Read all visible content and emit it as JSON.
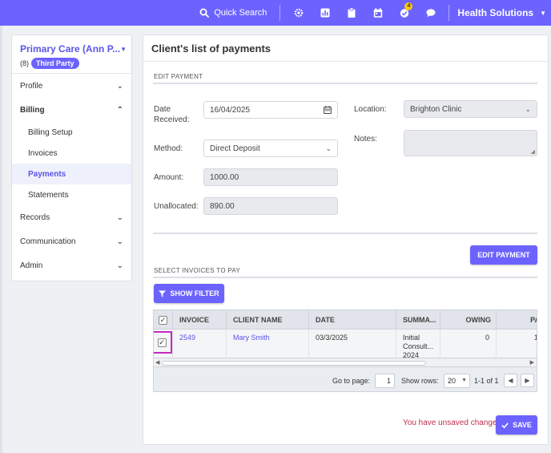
{
  "topbar": {
    "quick_search": "Quick Search",
    "org_name": "Health Solutions",
    "notifications_badge": "4",
    "accent": "#6c63ff"
  },
  "sidebar": {
    "patient_name": "Primary Care (Ann P...",
    "patient_count": "(8)",
    "patient_badge": "Third Party",
    "items": [
      {
        "label": "Profile",
        "chevron": "down"
      },
      {
        "label": "Billing",
        "chevron": "up"
      },
      {
        "label": "Records",
        "chevron": "down"
      },
      {
        "label": "Communication",
        "chevron": "down"
      },
      {
        "label": "Admin",
        "chevron": "down"
      }
    ],
    "billing_sub": [
      "Billing Setup",
      "Invoices",
      "Payments",
      "Statements"
    ],
    "active_sub": "Payments"
  },
  "main": {
    "title": "Client's list of payments",
    "edit_section": "EDIT PAYMENT",
    "form": {
      "date_label_1": "Date",
      "date_label_2": "Received:",
      "date_value": "16/04/2025",
      "method_label": "Method:",
      "method_value": "Direct Deposit",
      "amount_label": "Amount:",
      "amount_value": "1000.00",
      "unallocated_label": "Unallocated:",
      "unallocated_value": "890.00",
      "location_label": "Location:",
      "location_value": "Brighton Clinic",
      "notes_label": "Notes:",
      "notes_value": ""
    },
    "edit_button": "EDIT PAYMENT",
    "invoices_section": "SELECT INVOICES TO PAY",
    "filter_button": "SHOW FILTER",
    "grid": {
      "columns": [
        "INVOICE",
        "CLIENT NAME",
        "DATE",
        "SUMMA...",
        "OWING",
        "PA"
      ],
      "rows": [
        {
          "invoice": "2549",
          "client": "Mary Smith",
          "date": "03/3/2025",
          "summary_1": "Initial",
          "summary_2": "Consult...",
          "summary_3": "2024",
          "owing": "0",
          "paid": "1"
        }
      ]
    },
    "pager": {
      "goto_label": "Go to page:",
      "page": "1",
      "rows_label": "Show rows:",
      "rows": "20",
      "range": "1-1 of 1"
    },
    "unsaved": "You have unsaved changes",
    "save_button": "SAVE"
  }
}
